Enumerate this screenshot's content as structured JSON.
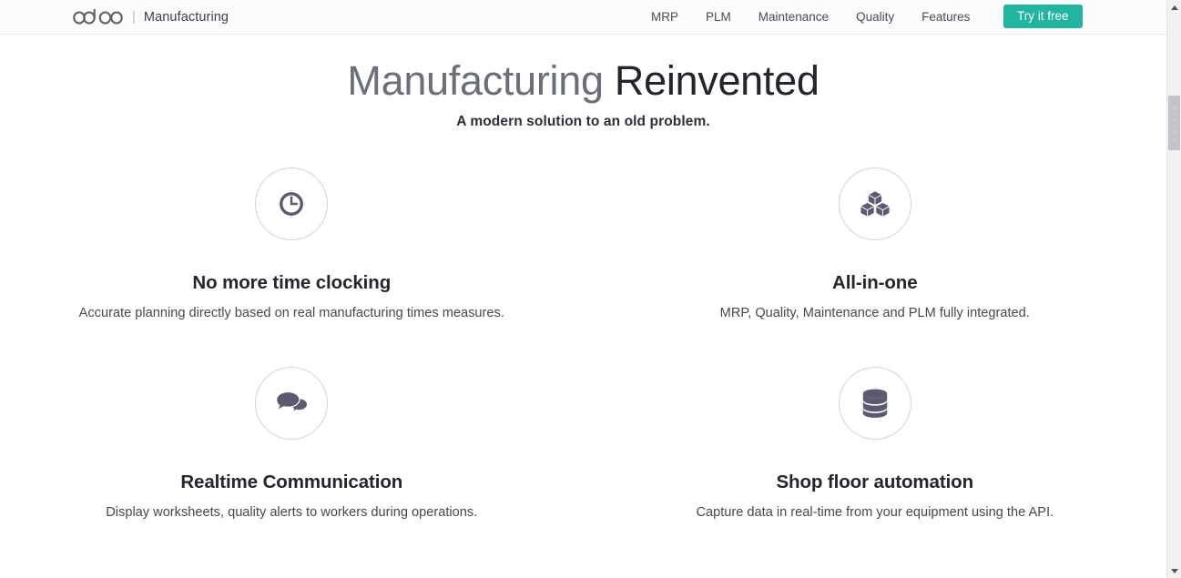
{
  "header": {
    "logo_text": "odoo",
    "logo_icon": "odoo-logo",
    "divider": "|",
    "app_name": "Manufacturing",
    "nav_links": [
      {
        "label": "MRP",
        "name": "nav-link-mrp"
      },
      {
        "label": "PLM",
        "name": "nav-link-plm"
      },
      {
        "label": "Maintenance",
        "name": "nav-link-maintenance"
      },
      {
        "label": "Quality",
        "name": "nav-link-quality"
      },
      {
        "label": "Features",
        "name": "nav-link-features"
      }
    ],
    "cta_label": "Try it free",
    "cta_color": "#21b5a0"
  },
  "hero": {
    "title_light": "Manufacturing",
    "title_bold": "Reinvented",
    "subtitle": "A modern solution to an old problem."
  },
  "features": [
    {
      "icon": "clock-icon",
      "title": "No more time clocking",
      "description": "Accurate planning directly based on real manufacturing times measures."
    },
    {
      "icon": "cubes-icon",
      "title": "All-in-one",
      "description": "MRP, Quality, Maintenance and PLM fully integrated."
    },
    {
      "icon": "comments-icon",
      "title": "Realtime Communication",
      "description": "Display worksheets, quality alerts to workers during operations."
    },
    {
      "icon": "database-icon",
      "title": "Shop floor automation",
      "description": "Capture data in real-time from your equipment using the API."
    }
  ],
  "scrollbar": {
    "up_arrow": "scroll-up-arrow",
    "down_arrow": "scroll-down-arrow",
    "thumb": "scroll-thumb"
  },
  "colors": {
    "accent": "#21b5a0",
    "icon": "#5a5b70",
    "heading": "#23262d",
    "body_text": "#45484f",
    "circle_border": "#d3d4d8",
    "page_background": "#ffffff"
  }
}
